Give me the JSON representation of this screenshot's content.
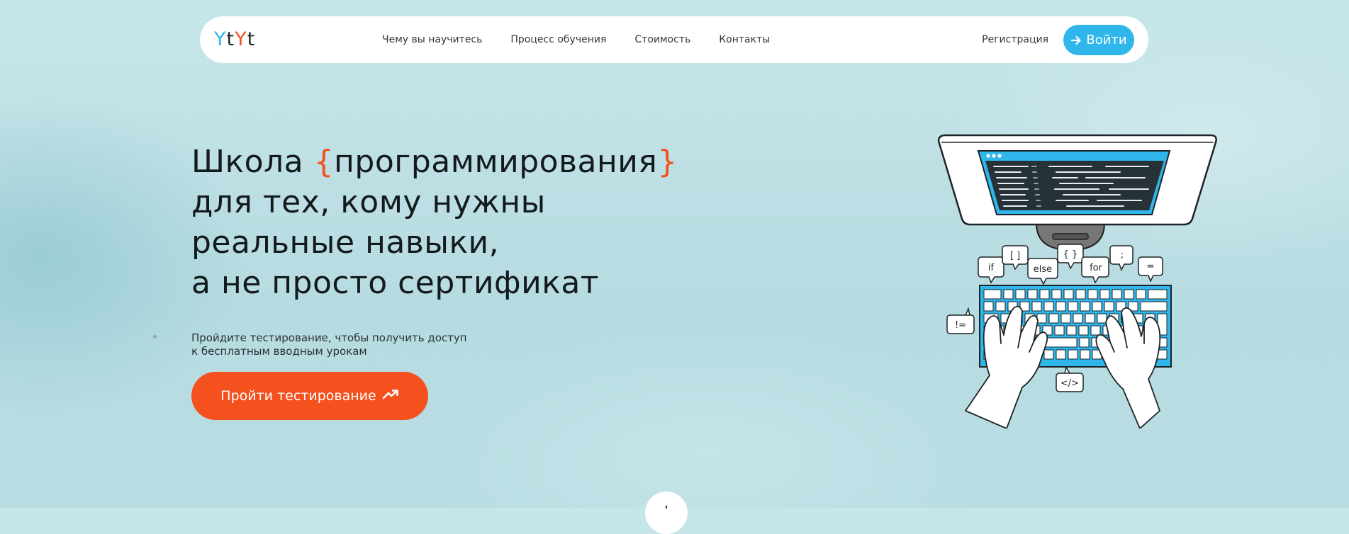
{
  "logo": {
    "letters": [
      "Y",
      "t",
      "Y",
      "t"
    ],
    "colors": [
      "#2fb7ec",
      "#1e2427",
      "#f4511e",
      "#1e2427"
    ]
  },
  "nav": {
    "items": [
      {
        "label": "Чему вы научитесь"
      },
      {
        "label": "Процесс обучения"
      },
      {
        "label": "Стоимость"
      },
      {
        "label": "Контакты"
      }
    ],
    "register_label": "Регистрация",
    "login_label": "Войти",
    "login_icon": "arrow-right-icon"
  },
  "hero": {
    "title_line1_pre": "Школа ",
    "title_brace_open": "{",
    "title_line1_word": "программирования",
    "title_brace_close": "}",
    "title_line2": "для тех, кому нужны",
    "title_line3": "реальные навыки,",
    "title_line4": "а не просто сертификат",
    "subtitle_line1": "Пройдите тестирование, чтобы получить доступ",
    "subtitle_line2": "к бесплатным вводным урокам",
    "cta_label": "Пройти тестирование",
    "cta_icon": "trending-up-icon"
  },
  "illustration": {
    "bubbles": [
      "if",
      "[ ]",
      "else",
      "{ }",
      "for",
      ";",
      "=",
      "!=",
      "</>"
    ]
  },
  "colors": {
    "accent_blue": "#2fb7ec",
    "accent_orange": "#f4511e",
    "text_dark": "#131a1c"
  }
}
